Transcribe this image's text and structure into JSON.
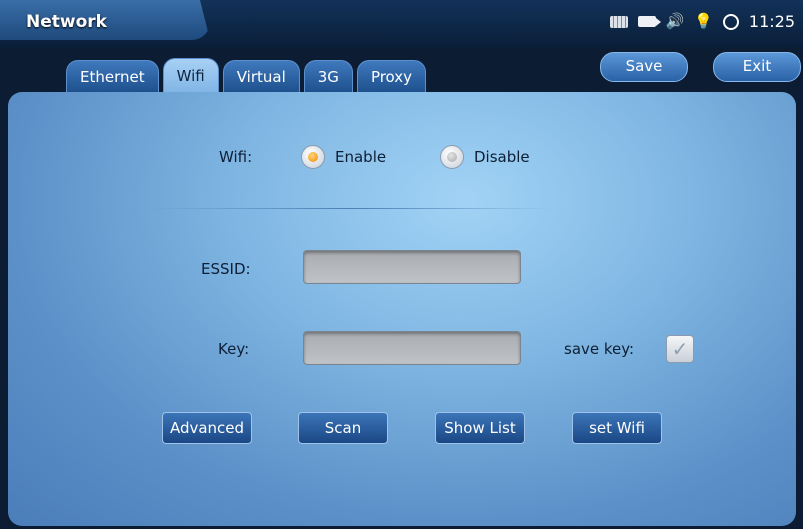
{
  "app": {
    "title": "Network"
  },
  "status": {
    "time": "11:25",
    "icons": [
      "keyboard-icon",
      "camera-icon",
      "speaker-icon",
      "bulb-icon",
      "sync-icon"
    ]
  },
  "header": {
    "save_label": "Save",
    "exit_label": "Exit"
  },
  "tabs": [
    {
      "label": "Ethernet",
      "active": false
    },
    {
      "label": "Wifi",
      "active": true
    },
    {
      "label": "Virtual",
      "active": false
    },
    {
      "label": "3G",
      "active": false
    },
    {
      "label": "Proxy",
      "active": false
    }
  ],
  "wifi": {
    "label": "Wifi:",
    "enable_label": "Enable",
    "disable_label": "Disable",
    "selected": "Enable"
  },
  "form": {
    "essid_label": "ESSID:",
    "essid_value": "",
    "key_label": "Key:",
    "key_value": "",
    "save_key_label": "save key:",
    "save_key_checked": true
  },
  "buttons": {
    "advanced": "Advanced",
    "scan": "Scan",
    "show_list": "Show List",
    "set_wifi": "set Wifi"
  }
}
